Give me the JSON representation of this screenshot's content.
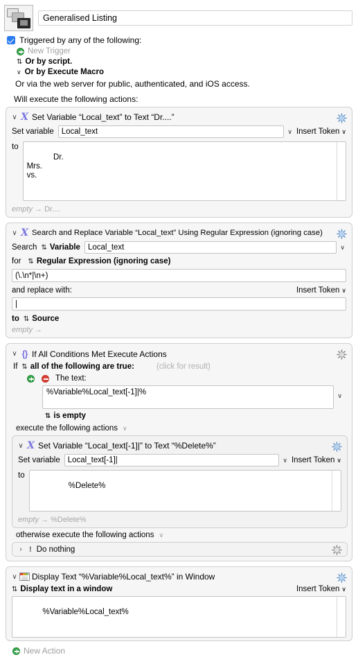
{
  "header": {
    "macro_icon_name": "macro-stack-icon",
    "title_value": "Generalised Listing"
  },
  "triggers": {
    "checkbox_label": "Triggered by any of the following:",
    "new_trigger_label": "New Trigger",
    "or_by_script": "Or by script.",
    "or_by_execute_macro": "Or by Execute Macro",
    "web_server_note": "Or via the web server for public, authenticated, and iOS access."
  },
  "actions_intro": "Will execute the following actions:",
  "common": {
    "insert_token": "Insert Token",
    "set_variable_label": "Set variable",
    "to_label": "to",
    "empty_label": "empty",
    "arrow": "→",
    "gear_icon": "gear-icon",
    "disclosure_open": "∨",
    "disclosure_closed": "›",
    "updown_glyph": "⇅",
    "chevron_down": "∨"
  },
  "action1": {
    "icon": "set-variable-icon",
    "title": "Set Variable “Local_text” to Text “Dr....”",
    "variable_name": "Local_text",
    "text_value": "Dr.\nMrs.\nvs.",
    "footer_from": "empty",
    "footer_to": "Dr...."
  },
  "action2": {
    "icon": "search-replace-icon",
    "title": "Search and Replace Variable “Local_text” Using Regular Expression (ignoring case)",
    "search_label": "Search",
    "search_target": "Variable",
    "search_variable": "Local_text",
    "for_label": "for",
    "search_mode": "Regular Expression (ignoring case)",
    "regex_value": "(\\.\\n*|\\n+)",
    "replace_label": "and replace with:",
    "replace_value": "|",
    "to_label": "to",
    "to_target": "Source",
    "footer_from": "empty"
  },
  "action3": {
    "icon": "if-conditions-icon",
    "title": "If All Conditions Met Execute Actions",
    "if_label": "If",
    "condition_mode": "all of the following are true:",
    "click_for_result": "(click for result)",
    "add_condition_icon": "plus-circle-icon",
    "remove_condition_icon": "minus-circle-icon",
    "the_text_label": "The text:",
    "condition_value": "%Variable%Local_text[-1]|%",
    "operator": "is empty",
    "then_label": "execute the following actions",
    "else_label": "otherwise execute the following actions",
    "nested": {
      "icon": "set-variable-icon",
      "title": "Set Variable “Local_text[-1]|” to Text “%Delete%”",
      "variable_name": "Local_text[-1]|",
      "text_value": "%Delete%",
      "footer_from": "empty",
      "footer_to": "%Delete%"
    },
    "else_action": {
      "icon": "alert-icon",
      "label": "Do nothing"
    }
  },
  "action4": {
    "icon": "display-text-window-icon",
    "title": "Display Text “%Variable%Local_text%” in Window",
    "mode": "Display text in a window",
    "text_value": "%Variable%Local_text%"
  },
  "new_action": {
    "icon": "plus-circle-icon",
    "label": "New Action"
  },
  "colors": {
    "accent_blue": "#2a7bf0",
    "action_icon_purple": "#7b76e0",
    "gear_blue": "#aac8e8",
    "add_green": "#37a34a",
    "remove_red": "#d93f35",
    "muted_gray": "#a0a0a0",
    "panel_bg": "#f6f6f6"
  }
}
